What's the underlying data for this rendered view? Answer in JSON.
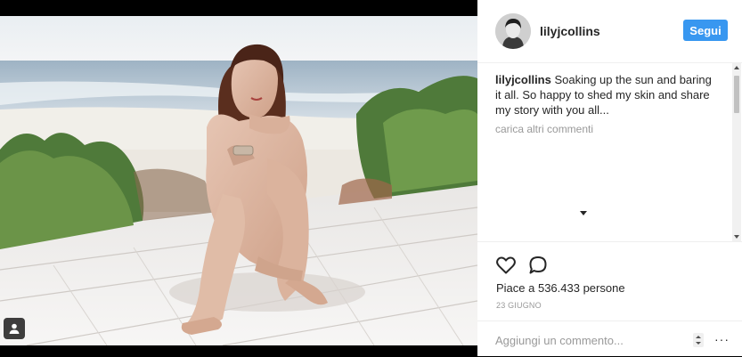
{
  "post": {
    "photo_alt": "Photo by lilyjcollins",
    "icon_tag": "person-tag-icon"
  },
  "header": {
    "username": "lilyjcollins",
    "follow_label": "Segui"
  },
  "comments": {
    "caption_user": "lilyjcollins",
    "caption_text": " Soaking up the sun and baring it all. So happy to shed my skin and share my story with you all...",
    "load_more": "carica altri commenti"
  },
  "actions": {
    "icon_like": "heart-icon",
    "icon_comment": "comment-bubble-icon"
  },
  "likes": "Piace a 536.433 persone",
  "date": "23 GIUGNO",
  "add_comment": {
    "placeholder": "Aggiungi un commento...",
    "more_options": "···"
  },
  "colors": {
    "accent": "#3897f0",
    "text": "#262626",
    "muted": "#999999"
  }
}
